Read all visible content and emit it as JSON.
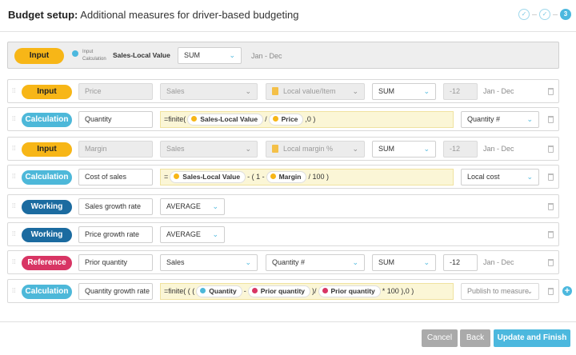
{
  "header": {
    "title_bold": "Budget setup:",
    "title_rest": "Additional measures for driver-based budgeting",
    "steps": [
      "✓",
      "✓",
      "3"
    ]
  },
  "topbar": {
    "type": "Input",
    "toggle_top": "Input",
    "toggle_bottom": "Calculation",
    "measure": "Sales-Local Value",
    "aggregation": "SUM",
    "period": "Jan - Dec"
  },
  "rows": [
    {
      "type": "Input",
      "name": "Price",
      "dim": "Sales",
      "unit": "Local value/Item",
      "agg": "SUM",
      "offset": "-12",
      "period": "Jan - Dec"
    },
    {
      "type": "Calculation",
      "name": "Quantity",
      "f1": "=finite(",
      "c1": "Sales-Local Value",
      "f2": "/",
      "c2": "Price",
      "f3": ",0 )",
      "target": "Quantity #"
    },
    {
      "type": "Input",
      "name": "Margin",
      "dim": "Sales",
      "unit": "Local margin %",
      "agg": "SUM",
      "offset": "-12",
      "period": "Jan - Dec"
    },
    {
      "type": "Calculation",
      "name": "Cost of sales",
      "f1": "=",
      "c1": "Sales-Local Value",
      "f2": "- ( 1 -",
      "c2": "Margin",
      "f3": "/ 100 )",
      "target": "Local cost"
    },
    {
      "type": "Working",
      "name": "Sales growth rate",
      "agg": "AVERAGE"
    },
    {
      "type": "Working",
      "name": "Price growth rate",
      "agg": "AVERAGE"
    },
    {
      "type": "Reference",
      "name": "Prior quantity",
      "dim": "Sales",
      "unit": "Quantity #",
      "agg": "SUM",
      "offset": "-12",
      "period": "Jan - Dec"
    },
    {
      "type": "Calculation",
      "name": "Quantity growth rate",
      "f1": "=finite( ( (",
      "c1": "Quantity",
      "f2": "-",
      "c2": "Prior quantity",
      "f3": ")/",
      "c3": "Prior quantity",
      "f4": "* 100 ),0 )",
      "target": "Publish to measure"
    }
  ],
  "footer": {
    "cancel": "Cancel",
    "back": "Back",
    "finish": "Update and Finish"
  },
  "colors": {
    "input": "#f7b617",
    "calculation": "#4db8d9",
    "working": "#1b6ba0",
    "reference": "#d83564",
    "accent": "#4cb8de"
  }
}
